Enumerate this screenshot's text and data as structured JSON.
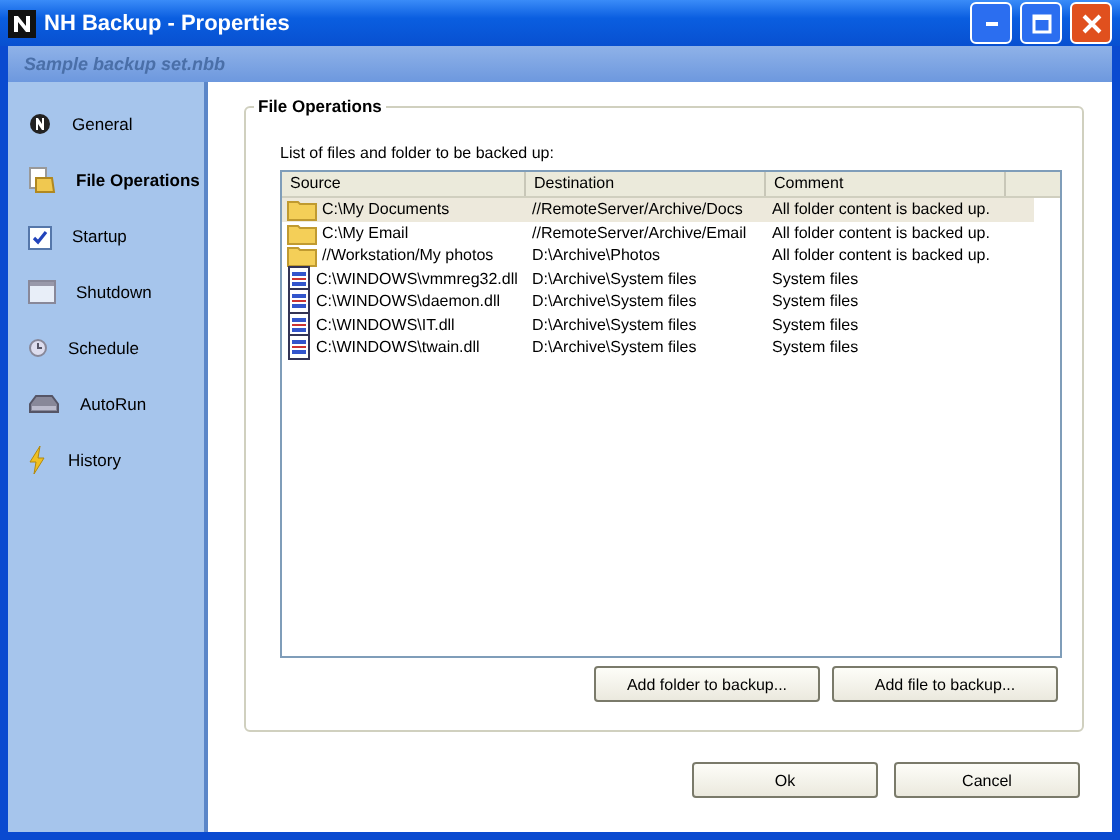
{
  "window": {
    "title": "NH Backup - Properties"
  },
  "subtitle": "Sample backup set.nbb",
  "sidebar": {
    "items": [
      {
        "label": "General",
        "kind": "general",
        "selected": false
      },
      {
        "label": "File Operations",
        "kind": "files",
        "selected": true
      },
      {
        "label": "Startup",
        "kind": "startup",
        "selected": false
      },
      {
        "label": "Shutdown",
        "kind": "shutdown",
        "selected": false
      },
      {
        "label": "Schedule",
        "kind": "schedule",
        "selected": false
      },
      {
        "label": "AutoRun",
        "kind": "autorun",
        "selected": false
      },
      {
        "label": "History",
        "kind": "history",
        "selected": false
      }
    ]
  },
  "group": {
    "title": "File Operations",
    "caption": "List of files and folder to be backed up:",
    "table": {
      "columns": [
        "Source",
        "Destination",
        "Comment"
      ],
      "rows": [
        {
          "kind": "folder",
          "selected": true,
          "cells": [
            "C:\\My Documents",
            "//RemoteServer/Archive/Docs",
            "All folder content is backed up."
          ]
        },
        {
          "kind": "folder",
          "selected": false,
          "cells": [
            "C:\\My Email",
            "//RemoteServer/Archive/Email",
            "All folder content is backed up."
          ]
        },
        {
          "kind": "folder",
          "selected": false,
          "cells": [
            "//Workstation/My photos",
            "D:\\Archive\\Photos",
            "All folder content is backed up."
          ]
        },
        {
          "kind": "file",
          "selected": false,
          "cells": [
            "C:\\WINDOWS\\vmmreg32.dll",
            "D:\\Archive\\System files",
            "System files"
          ]
        },
        {
          "kind": "file",
          "selected": false,
          "cells": [
            "C:\\WINDOWS\\daemon.dll",
            "D:\\Archive\\System files",
            "System files"
          ]
        },
        {
          "kind": "file",
          "selected": false,
          "cells": [
            "C:\\WINDOWS\\IT.dll",
            "D:\\Archive\\System files",
            "System files"
          ]
        },
        {
          "kind": "file",
          "selected": false,
          "cells": [
            "C:\\WINDOWS\\twain.dll",
            "D:\\Archive\\System files",
            "System files"
          ]
        }
      ]
    },
    "buttons": [
      "Add folder to backup...",
      "Add file to backup..."
    ]
  },
  "buttons": [
    "Ok",
    "Cancel"
  ]
}
